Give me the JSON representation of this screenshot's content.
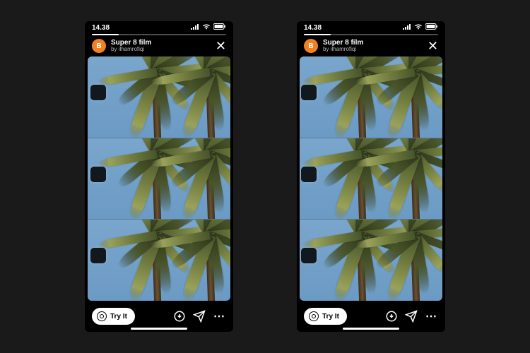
{
  "status": {
    "time": "14.38",
    "signal_icon": "signal-icon",
    "wifi_icon": "wifi-icon",
    "battery_icon": "battery-icon"
  },
  "filter": {
    "avatar_letter": "B",
    "name": "Super 8 film",
    "author": "by ilhamrofiqi",
    "close_glyph": "✕"
  },
  "try_button": {
    "label": "Try It",
    "camera_icon": "camera-icon"
  },
  "actions": {
    "save_icon": "save-icon",
    "share_icon": "send-icon",
    "more_icon": "more-icon",
    "more_glyph": "⋯"
  },
  "content": {
    "description": "Super 8 film filter preview: three stacked filmstrip frames of palm trees against blue sky with left-edge sprocket holes",
    "strips_count": 3
  },
  "layout": {
    "phones_count": 2,
    "note": "Two identical phone mockups side by side; right instance content nudged slightly left"
  }
}
